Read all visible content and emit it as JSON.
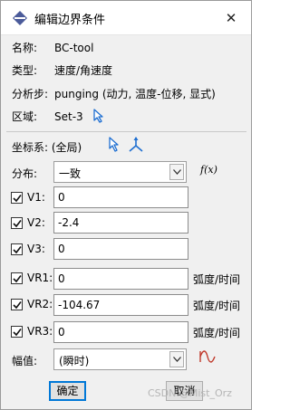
{
  "window": {
    "title": "编辑边界条件",
    "close_glyph": "✕"
  },
  "info": {
    "name_label": "名称:",
    "name_value": "BC-tool",
    "type_label": "类型:",
    "type_value": "速度/角速度",
    "step_label": "分析步:",
    "step_value": "punging (动力, 温度-位移, 显式)",
    "region_label": "区域:",
    "region_value": "Set-3"
  },
  "csys": {
    "label": "坐标系: (全局)"
  },
  "distribution": {
    "label": "分布:",
    "selected": "一致",
    "fx_label": "f(x)"
  },
  "fields": [
    {
      "label": "V1:",
      "checked": true,
      "value": "0",
      "unit": ""
    },
    {
      "label": "V2:",
      "checked": true,
      "value": "-2.4",
      "unit": ""
    },
    {
      "label": "V3:",
      "checked": true,
      "value": "0",
      "unit": ""
    },
    {
      "label": "VR1:",
      "checked": true,
      "value": "0",
      "unit": "弧度/时间"
    },
    {
      "label": "VR2:",
      "checked": true,
      "value": "-104.67",
      "unit": "弧度/时间"
    },
    {
      "label": "VR3:",
      "checked": true,
      "value": "0",
      "unit": "弧度/时间"
    }
  ],
  "amplitude": {
    "label": "幅值:",
    "selected": "(瞬时)"
  },
  "buttons": {
    "ok": "确定",
    "cancel": "取消"
  },
  "watermark": "CSDN @Mist_Orz",
  "colors": {
    "accent": "#0078d7",
    "icon_blue": "#1f6fd1",
    "amp_red": "#c0392b",
    "title_icon": "#4b5b9a"
  }
}
